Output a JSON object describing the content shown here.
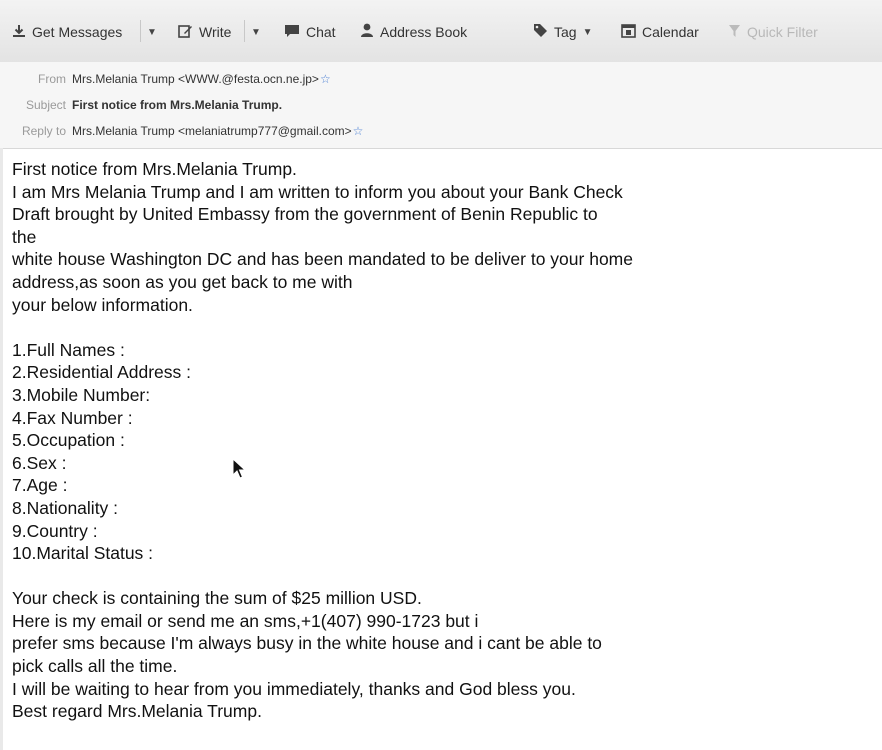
{
  "toolbar": {
    "get_messages": "Get Messages",
    "write": "Write",
    "chat": "Chat",
    "address_book": "Address Book",
    "tag": "Tag",
    "calendar": "Calendar",
    "quick_filter": "Quick Filter"
  },
  "header": {
    "from_label": "From",
    "from_value": "Mrs.Melania Trump <WWW.@festa.ocn.ne.jp>",
    "subject_label": "Subject",
    "subject_value": "First notice from Mrs.Melania Trump.",
    "reply_label": "Reply to",
    "reply_value": "Mrs.Melania Trump <melaniatrump777@gmail.com>"
  },
  "body": {
    "intro": [
      "First notice from Mrs.Melania Trump.",
      "I am Mrs Melania Trump and I am written to inform you about your Bank Check",
      "Draft brought by United Embassy from the government of Benin Republic to",
      "the",
      "white house Washington DC and has been mandated to be deliver to your home",
      "address,as soon as you get back to me with",
      "your below information."
    ],
    "list": [
      "1.Full Names :",
      "2.Residential Address :",
      "3.Mobile Number:",
      "4.Fax Number :",
      "5.Occupation :",
      "6.Sex :",
      "7.Age :",
      "8.Nationality :",
      "9.Country :",
      "10.Marital Status :"
    ],
    "closing": [
      "Your check is containing the sum of $25 million USD.",
      "Here is my email or send me an sms,+1(407) 990-1723 but i",
      "prefer sms because I'm always busy in the white house and i cant be able to",
      "pick calls all the time.",
      "I will be waiting to hear from you immediately, thanks and God bless you.",
      "Best regard Mrs.Melania Trump."
    ]
  },
  "icons": {
    "get_messages": "download-icon",
    "write": "pencil-icon",
    "chat": "chat-bubble-icon",
    "address_book": "person-icon",
    "tag": "tag-icon",
    "calendar": "calendar-icon",
    "quick_filter": "filter-icon",
    "star": "star-icon"
  },
  "colors": {
    "star": "#4a7fd4",
    "label": "#9a9a9a",
    "toolbar_bg": "#e8e8e8"
  }
}
